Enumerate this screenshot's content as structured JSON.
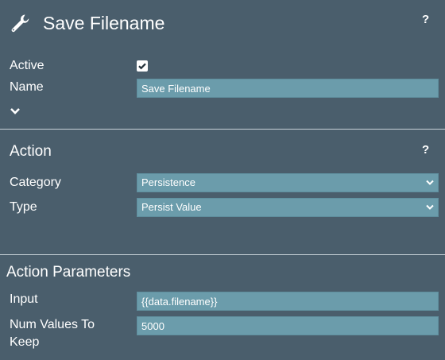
{
  "header": {
    "title": "Save Filename",
    "help": "?"
  },
  "general": {
    "active_label": "Active",
    "active_checked": true,
    "name_label": "Name",
    "name_value": "Save Filename"
  },
  "action": {
    "title": "Action",
    "help": "?",
    "category_label": "Category",
    "category_value": "Persistence",
    "type_label": "Type",
    "type_value": "Persist Value"
  },
  "parameters": {
    "title": "Action Parameters",
    "input_label": "Input",
    "input_value": "{{data.filename}}",
    "num_values_label_line1": "Num Values To",
    "num_values_label_line2": "Keep",
    "num_values_value": "5000"
  },
  "colors": {
    "background": "#4a5e6c",
    "field": "#6b9cab",
    "text": "#ffffff"
  }
}
